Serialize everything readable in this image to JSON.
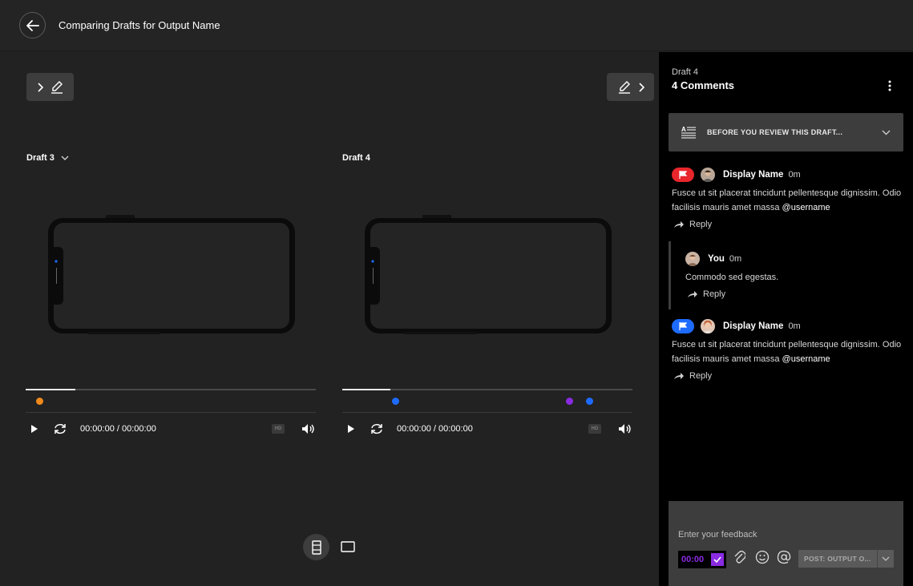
{
  "header": {
    "title": "Comparing Drafts for Output Name"
  },
  "players": [
    {
      "label": "Draft 3",
      "time": "00:00:00 / 00:00:00",
      "hd": "HD"
    },
    {
      "label": "Draft 4",
      "time": "00:00:00 / 00:00:00",
      "hd": "HD"
    }
  ],
  "panel": {
    "draft": "Draft 4",
    "count": "4 Comments",
    "before_review": "BEFORE YOU REVIEW THIS DRAFT...",
    "comments": [
      {
        "name": "Display Name",
        "time": "0m",
        "body": "Fusce ut sit placerat tincidunt pellentesque dignissim. Odio facilisis mauris amet massa ",
        "mention": "@username",
        "reply": "Reply",
        "flag_color": "#e8262b"
      },
      {
        "name": "You",
        "time": "0m",
        "body": "Commodo sed egestas.",
        "reply": "Reply"
      },
      {
        "name": "Display Name",
        "time": "0m",
        "body": "Fusce ut sit placerat tincidunt pellentesque dignissim. Odio facilisis mauris amet massa ",
        "mention": "@username",
        "reply": "Reply",
        "flag_color": "#1e6bff"
      }
    ],
    "input": {
      "placeholder": "Enter your feedback",
      "timecode": "00:00",
      "post": "POST: OUTPUT O..."
    }
  },
  "colors": {
    "accent_purple": "#8a2be2",
    "marker_orange": "#f08a1c",
    "marker_blue": "#1e6bff",
    "marker_purple": "#8a2be2"
  }
}
